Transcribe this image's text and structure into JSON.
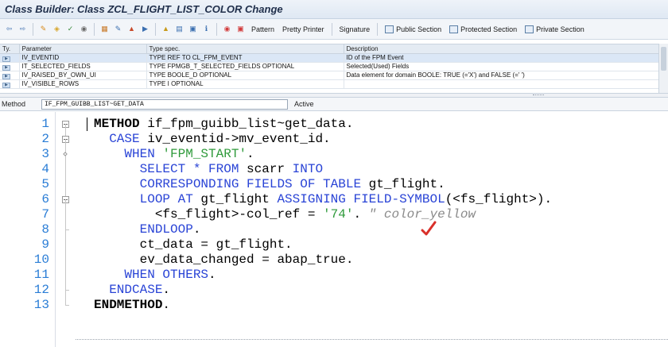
{
  "window": {
    "title": "Class Builder: Class ZCL_FLIGHT_LIST_COLOR Change"
  },
  "toolbar": {
    "icons": [
      "back-icon",
      "forward-icon",
      "display-change-icon",
      "activate-icon",
      "check-icon",
      "where-used-icon",
      "object-list-icon",
      "display-object-icon",
      "edit-icon",
      "insert-icon",
      "hierarchy-icon",
      "local-types-icon",
      "info-icon",
      "pattern-icon",
      "macros-icon"
    ],
    "buttons": {
      "pattern": "Pattern",
      "pretty_printer": "Pretty Printer",
      "signature": "Signature",
      "public_section": "Public Section",
      "protected_section": "Protected Section",
      "private_section": "Private Section"
    }
  },
  "params": {
    "headers": [
      "Ty.",
      "Parameter",
      "Type spec.",
      "Description"
    ],
    "rows": [
      {
        "name": "IV_EVENTID",
        "type_spec": "TYPE REF TO CL_FPM_EVENT",
        "description": "ID of the FPM Event"
      },
      {
        "name": "IT_SELECTED_FIELDS",
        "type_spec": "TYPE FPMGB_T_SELECTED_FIELDS OPTIONAL",
        "description": "Selected(Used) Fields"
      },
      {
        "name": "IV_RAISED_BY_OWN_UI",
        "type_spec": "TYPE BOOLE_D OPTIONAL",
        "description": "Data element for domain BOOLE: TRUE (='X') and FALSE (=' ')"
      },
      {
        "name": "IV_VISIBLE_ROWS",
        "type_spec": "TYPE I OPTIONAL",
        "description": ""
      }
    ]
  },
  "method_bar": {
    "label": "Method",
    "value": "IF_FPM_GUIBB_LIST~GET_DATA",
    "status": "Active"
  },
  "editor": {
    "lines": [
      {
        "n": "1",
        "tokens": [
          [
            "kwb",
            "METHOD"
          ],
          [
            "txt",
            " if_fpm_guibb_list~get_data."
          ]
        ]
      },
      {
        "n": "2",
        "tokens": [
          [
            "txt",
            "  "
          ],
          [
            "kw",
            "CASE"
          ],
          [
            "txt",
            " iv_eventid->mv_event_id."
          ]
        ]
      },
      {
        "n": "3",
        "tokens": [
          [
            "txt",
            "    "
          ],
          [
            "kw",
            "WHEN"
          ],
          [
            "txt",
            " "
          ],
          [
            "str",
            "'FPM_START'"
          ],
          [
            "txt",
            "."
          ]
        ]
      },
      {
        "n": "4",
        "tokens": [
          [
            "txt",
            "      "
          ],
          [
            "kw",
            "SELECT"
          ],
          [
            "txt",
            " "
          ],
          [
            "kw",
            "*"
          ],
          [
            "txt",
            " "
          ],
          [
            "kw",
            "FROM"
          ],
          [
            "txt",
            " scarr "
          ],
          [
            "kw",
            "INTO"
          ]
        ]
      },
      {
        "n": "5",
        "tokens": [
          [
            "txt",
            "      "
          ],
          [
            "kw",
            "CORRESPONDING FIELDS OF TABLE"
          ],
          [
            "txt",
            " gt_flight."
          ]
        ]
      },
      {
        "n": "6",
        "tokens": [
          [
            "txt",
            "      "
          ],
          [
            "kw",
            "LOOP AT"
          ],
          [
            "txt",
            " gt_flight "
          ],
          [
            "kw",
            "ASSIGNING FIELD-SYMBOL"
          ],
          [
            "txt",
            "(<fs_flight>)."
          ]
        ]
      },
      {
        "n": "7",
        "tokens": [
          [
            "txt",
            "        <fs_flight>-col_ref = "
          ],
          [
            "str",
            "'74'"
          ],
          [
            "txt",
            ". "
          ],
          [
            "cmt",
            "\" color_yellow"
          ]
        ]
      },
      {
        "n": "8",
        "tokens": [
          [
            "txt",
            "      "
          ],
          [
            "kw",
            "ENDLOOP"
          ],
          [
            "txt",
            "."
          ]
        ]
      },
      {
        "n": "9",
        "tokens": [
          [
            "txt",
            "      ct_data = gt_flight."
          ]
        ]
      },
      {
        "n": "10",
        "tokens": [
          [
            "txt",
            "      ev_data_changed = abap_true."
          ]
        ]
      },
      {
        "n": "11",
        "tokens": [
          [
            "txt",
            "    "
          ],
          [
            "kw",
            "WHEN OTHERS"
          ],
          [
            "txt",
            "."
          ]
        ]
      },
      {
        "n": "12",
        "tokens": [
          [
            "txt",
            "  "
          ],
          [
            "kw",
            "ENDCASE"
          ],
          [
            "txt",
            "."
          ]
        ]
      },
      {
        "n": "13",
        "tokens": [
          [
            "kwb",
            "ENDMETHOD"
          ],
          [
            "txt",
            "."
          ]
        ]
      }
    ]
  },
  "colors": {
    "keyword": "#2a44d6",
    "string": "#2f9a3b",
    "comment": "#8a8a8a",
    "line_number": "#2a7dd6",
    "annotation_check": "#d9302a"
  }
}
